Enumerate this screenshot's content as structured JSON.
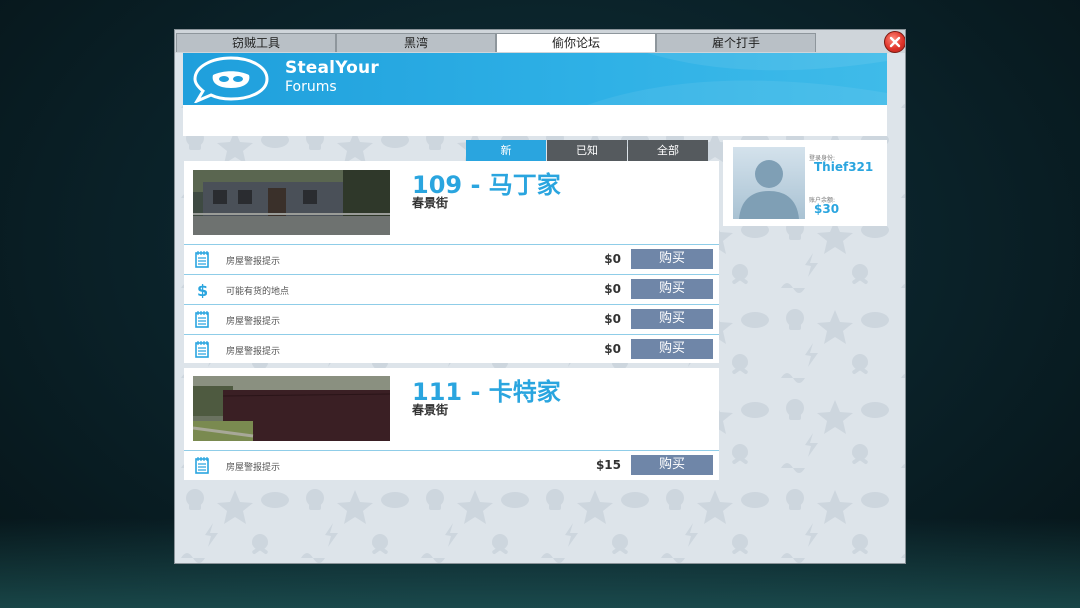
{
  "tabs": [
    {
      "label": "窃贼工具",
      "active": false
    },
    {
      "label": "黑湾",
      "active": false
    },
    {
      "label": "偷你论坛",
      "active": true
    },
    {
      "label": "雇个打手",
      "active": false
    }
  ],
  "logo": {
    "line1": "StealYour",
    "line2": "Forums"
  },
  "filters": [
    {
      "label": "新",
      "active": true
    },
    {
      "label": "已知",
      "active": false
    },
    {
      "label": "全部",
      "active": false
    }
  ],
  "listings": [
    {
      "title": "109 - 马丁家",
      "street": "春景街",
      "rows": [
        {
          "icon": "notepad-icon",
          "label": "房屋警报提示",
          "price": "$0",
          "button": "购买"
        },
        {
          "icon": "dollar-icon",
          "label": "可能有货的地点",
          "price": "$0",
          "button": "购买"
        },
        {
          "icon": "notepad-icon",
          "label": "房屋警报提示",
          "price": "$0",
          "button": "购买"
        },
        {
          "icon": "notepad-icon",
          "label": "房屋警报提示",
          "price": "$0",
          "button": "购买"
        }
      ]
    },
    {
      "title": "111 - 卡特家",
      "street": "春景街",
      "rows": [
        {
          "icon": "notepad-icon",
          "label": "房屋警报提示",
          "price": "$15",
          "button": "购买"
        }
      ]
    }
  ],
  "profile": {
    "identity_label": "登录身份:",
    "username": "Thief321",
    "balance_label": "账户余额:",
    "balance": "$30"
  },
  "colors": {
    "accent": "#2aa5df",
    "button": "#6f86a8",
    "close": "#e0342a"
  }
}
